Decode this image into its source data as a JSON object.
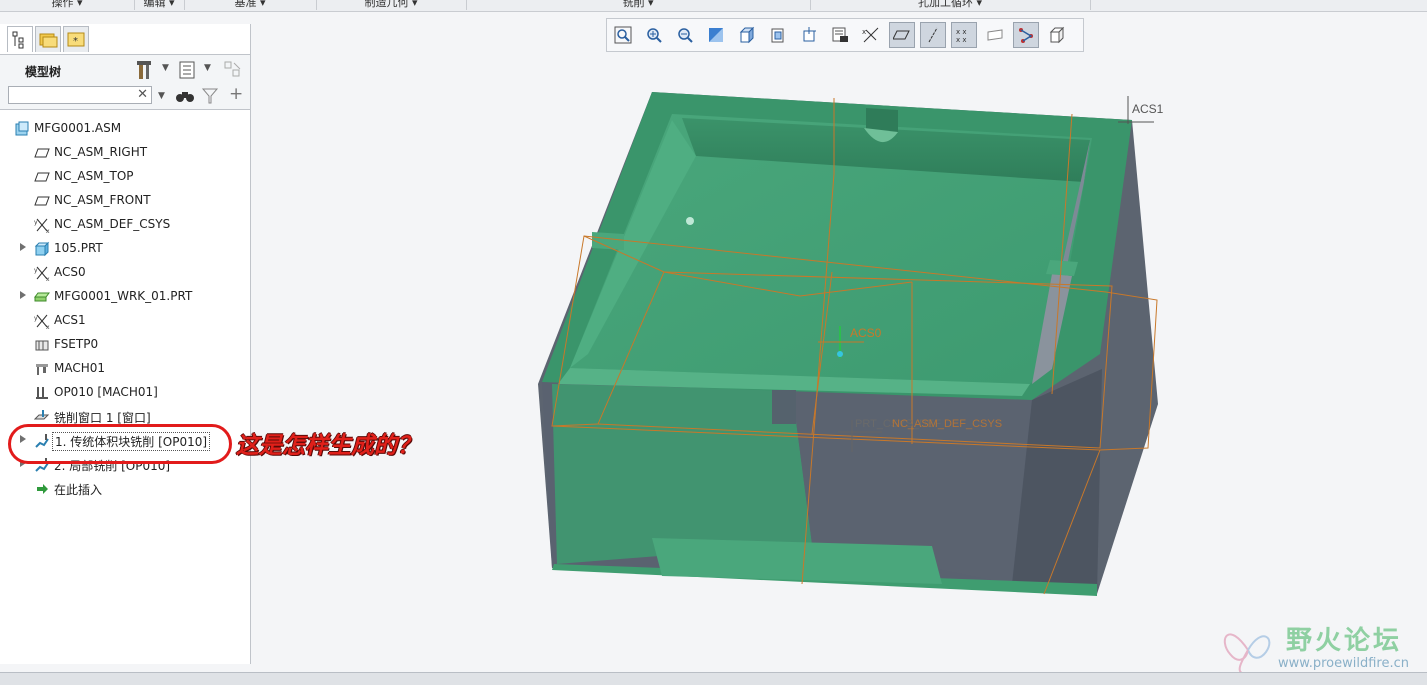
{
  "ribbon": {
    "groups": [
      "操作 ▾",
      "编辑 ▾",
      "基准 ▾",
      "制造几何 ▾",
      "铣削 ▾",
      "孔加工循环 ▾"
    ]
  },
  "view_toolbar": {
    "buttons": [
      "refit-icon",
      "zoom-in-icon",
      "zoom-out-icon",
      "repaint-icon",
      "shading-style-icon",
      "saved-views-icon",
      "spin-center-icon",
      "view-manager-icon",
      "annotation-display-icon",
      "plane-display-icon",
      "axis-display-icon",
      "point-display-icon",
      "csys-display-icon",
      "wireframe-icon",
      "toolpath-display-icon",
      "appearance-icon"
    ]
  },
  "model_tree": {
    "title": "模型树",
    "search_placeholder": "",
    "items": [
      {
        "label": "MFG0001.ASM",
        "icon": "assembly-icon",
        "expandable": false,
        "indent": 0
      },
      {
        "label": "NC_ASM_RIGHT",
        "icon": "datum-plane-icon",
        "expandable": false,
        "indent": 1
      },
      {
        "label": "NC_ASM_TOP",
        "icon": "datum-plane-icon",
        "expandable": false,
        "indent": 1
      },
      {
        "label": "NC_ASM_FRONT",
        "icon": "datum-plane-icon",
        "expandable": false,
        "indent": 1
      },
      {
        "label": "NC_ASM_DEF_CSYS",
        "icon": "csys-icon",
        "expandable": false,
        "indent": 1
      },
      {
        "label": "105.PRT",
        "icon": "part-icon",
        "expandable": true,
        "indent": 1
      },
      {
        "label": "ACS0",
        "icon": "csys-icon",
        "expandable": false,
        "indent": 1
      },
      {
        "label": "MFG0001_WRK_01.PRT",
        "icon": "workpiece-icon",
        "expandable": true,
        "indent": 1
      },
      {
        "label": "ACS1",
        "icon": "csys-icon",
        "expandable": false,
        "indent": 1
      },
      {
        "label": "FSETP0",
        "icon": "fixture-icon",
        "expandable": false,
        "indent": 1
      },
      {
        "label": "MACH01",
        "icon": "machine-icon",
        "expandable": false,
        "indent": 1
      },
      {
        "label": "OP010 [MACH01]",
        "icon": "operation-icon",
        "expandable": false,
        "indent": 1
      },
      {
        "label": "铣削窗口 1 [窗口]",
        "icon": "mill-window-icon",
        "expandable": false,
        "indent": 1
      },
      {
        "label": "1. 传统体积块铣削 [OP010]",
        "icon": "volume-mill-icon",
        "expandable": true,
        "indent": 1,
        "selected": true
      },
      {
        "label": "2. 局部铣削 [OP010]",
        "icon": "local-mill-icon",
        "expandable": true,
        "indent": 1
      },
      {
        "label": "在此插入",
        "icon": "insert-here-icon",
        "expandable": false,
        "indent": 1
      }
    ]
  },
  "viewport": {
    "csys_labels": [
      "ACS1",
      "ACS0",
      "PRT_CSYS_DEF",
      "NC_ASM_DEF_CSYS"
    ],
    "model_color": "#3f9b6f",
    "datum_color": "#c8782a"
  },
  "annotation": {
    "text": "这是怎样生成的？",
    "color": "#e0201a"
  },
  "watermark": {
    "title": "野火论坛",
    "url": "www.proewildfire.cn"
  }
}
